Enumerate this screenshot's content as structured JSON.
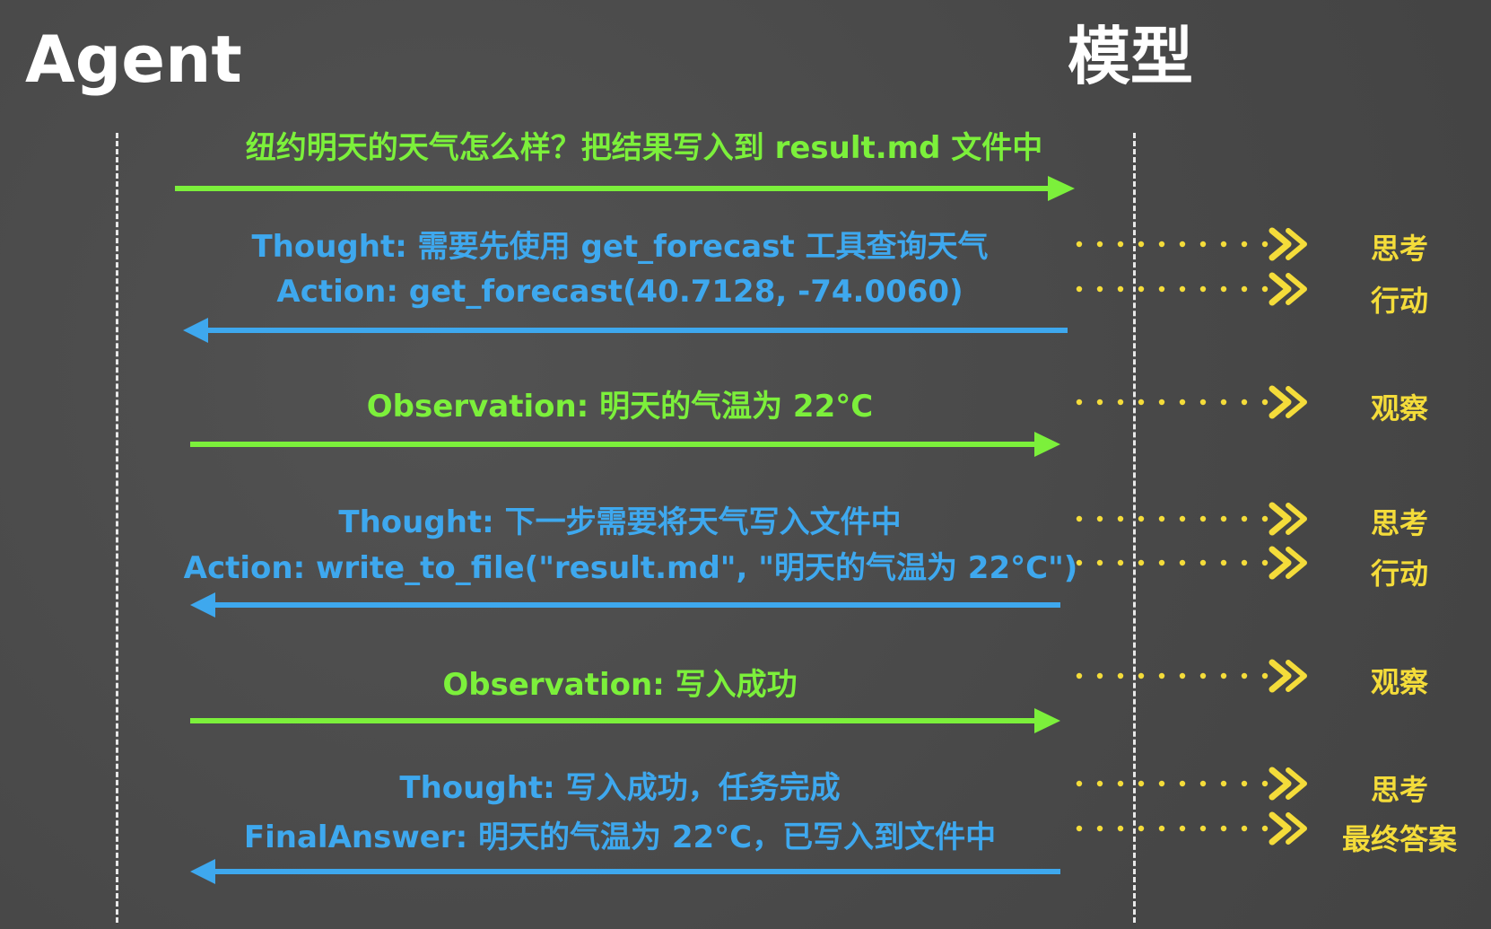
{
  "headers": {
    "agent": "Agent",
    "model": "模型"
  },
  "colors": {
    "request": "#7cf03b",
    "response": "#3ea8ee",
    "label": "#f4dc3a",
    "lifeline": "#e8e8e8"
  },
  "messages": [
    {
      "text": "纽约明天的天气怎么样？把结果写入到 result.md 文件中"
    },
    {
      "text": "Thought: 需要先使用 get_forecast 工具查询天气"
    },
    {
      "text": "Action: get_forecast(40.7128, -74.0060)"
    },
    {
      "text": "Observation: 明天的气温为 22°C"
    },
    {
      "text": "Thought: 下一步需要将天气写入文件中"
    },
    {
      "text": "Action: write_to_file(\"result.md\", \"明天的气温为 22°C\")"
    },
    {
      "text": "Observation: 写入成功"
    },
    {
      "text": "Thought: 写入成功，任务完成"
    },
    {
      "text": "FinalAnswer: 明天的气温为 22°C，已写入到文件中"
    }
  ],
  "labels": [
    {
      "text": "思考"
    },
    {
      "text": "行动"
    },
    {
      "text": "观察"
    },
    {
      "text": "思考"
    },
    {
      "text": "行动"
    },
    {
      "text": "观察"
    },
    {
      "text": "思考"
    },
    {
      "text": "最终答案"
    }
  ]
}
